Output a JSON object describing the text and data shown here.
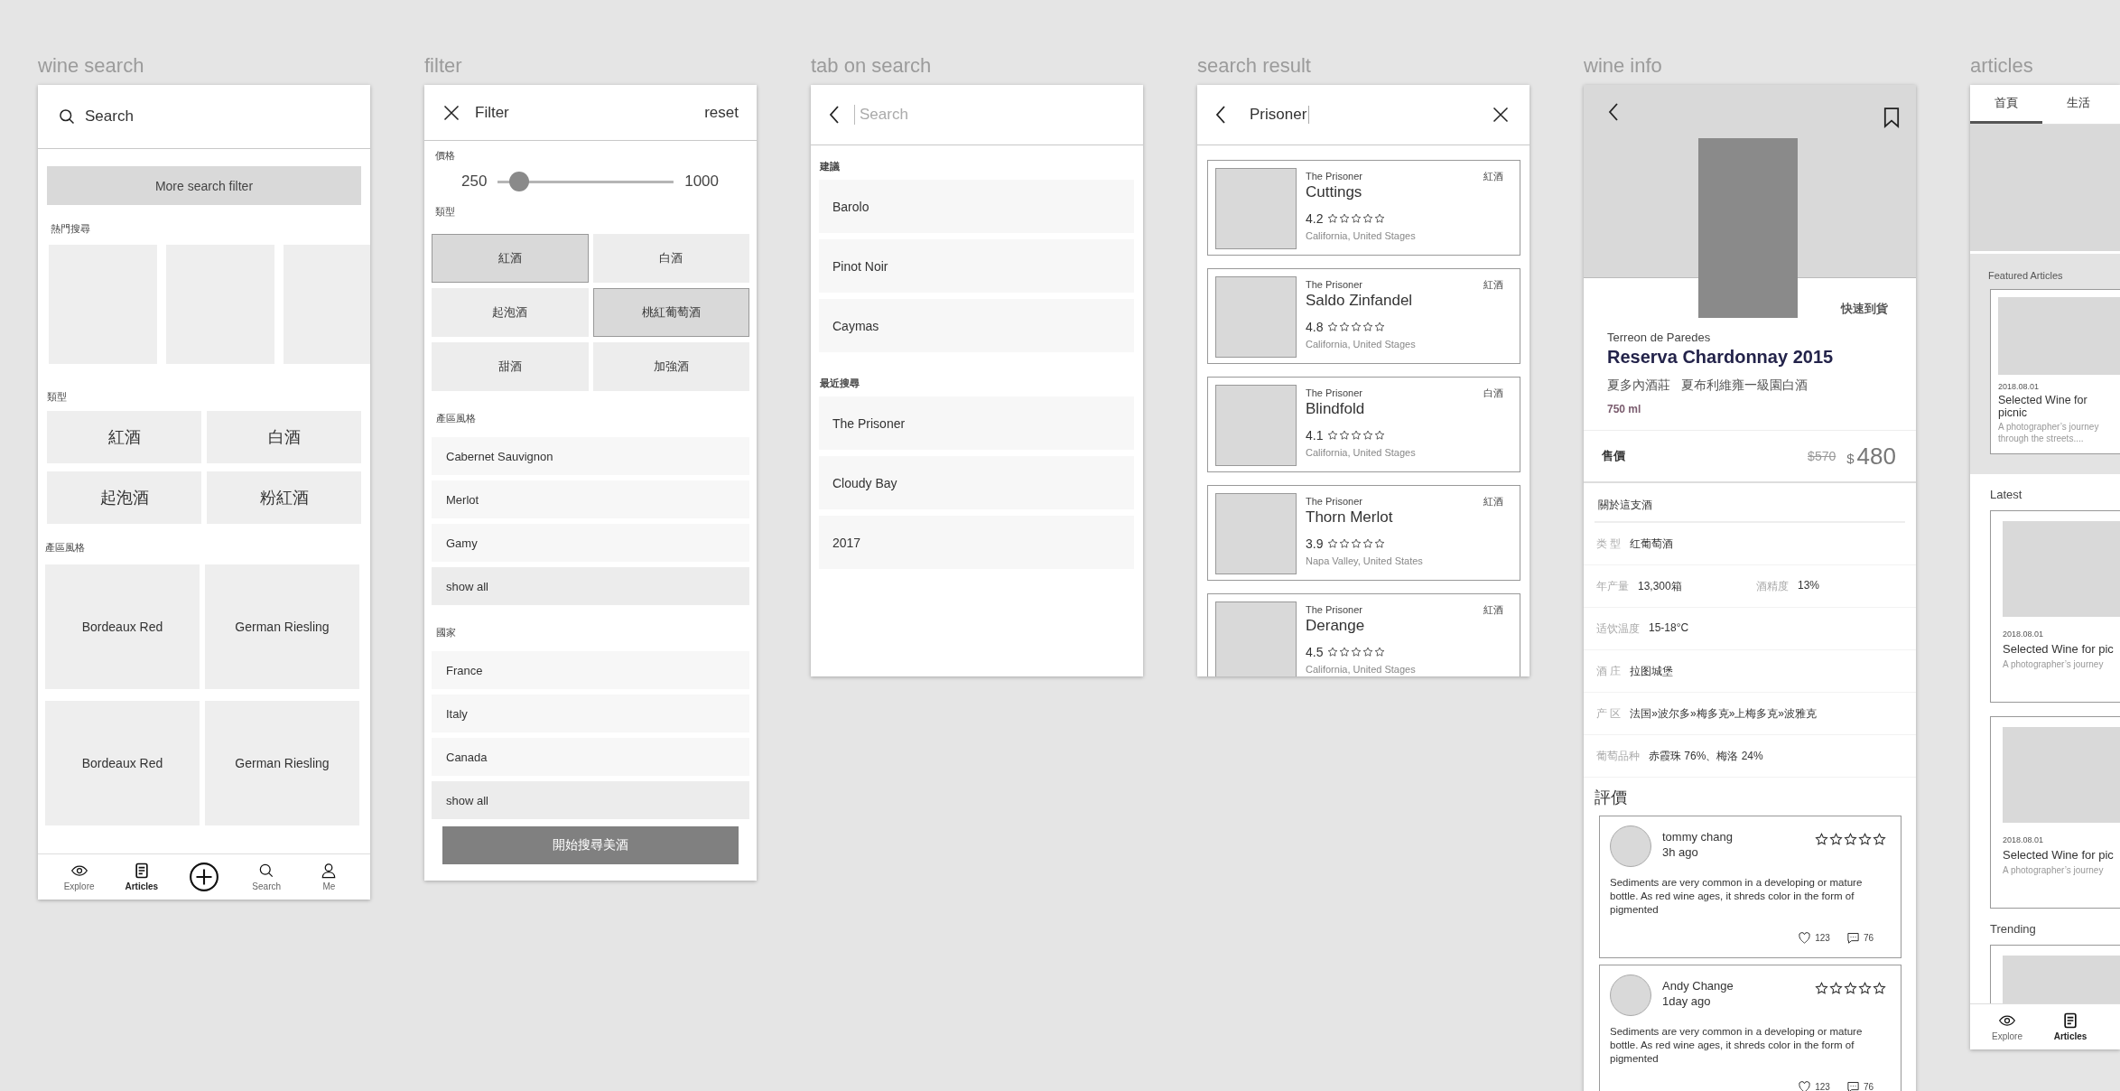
{
  "wine_search": {
    "title": "wine search",
    "search": {
      "placeholder": "Search"
    },
    "filter_button": "More search filter",
    "popular": {
      "heading": "熱門搜尋"
    },
    "types": {
      "heading": "類型",
      "items": [
        "紅酒",
        "白酒",
        "起泡酒",
        "粉紅酒"
      ]
    },
    "regions": {
      "heading": "產區風格",
      "items": [
        "Bordeaux Red",
        "German Riesling",
        "Bordeaux Red",
        "German Riesling"
      ]
    },
    "nav": [
      {
        "kind": "explore",
        "label": "Explore",
        "selected": false
      },
      {
        "kind": "articles",
        "label": "Articles",
        "selected": true
      },
      {
        "kind": "add",
        "selected": false
      },
      {
        "kind": "search",
        "label": "Search",
        "selected": false
      },
      {
        "kind": "me",
        "label": "Me",
        "selected": false
      }
    ]
  },
  "filter": {
    "title": "filter",
    "header": {
      "title": "Filter",
      "reset": "reset"
    },
    "price": {
      "heading": "價格",
      "min": "250",
      "max": "1000",
      "level": 0.12
    },
    "types": {
      "heading": "類型",
      "items": [
        {
          "label": "紅酒",
          "selected": true
        },
        {
          "label": "白酒",
          "selected": false
        },
        {
          "label": "起泡酒",
          "selected": false
        },
        {
          "label": "桃紅葡萄酒",
          "selected": true
        },
        {
          "label": "甜酒",
          "selected": false
        },
        {
          "label": "加強酒",
          "selected": false
        }
      ]
    },
    "regions": {
      "heading": "產區風格",
      "items": [
        {
          "kind": "option",
          "label": "Cabernet Sauvignon"
        },
        {
          "kind": "option",
          "label": "Merlot"
        },
        {
          "kind": "option",
          "label": "Gamy"
        },
        {
          "kind": "more",
          "label": "show all"
        }
      ]
    },
    "countries": {
      "heading": "國家",
      "items": [
        {
          "kind": "option",
          "label": "France"
        },
        {
          "kind": "option",
          "label": "Italy"
        },
        {
          "kind": "option",
          "label": "Canada"
        },
        {
          "kind": "more",
          "label": "show all"
        }
      ]
    },
    "submit": "開始搜尋美酒"
  },
  "tab_on_search": {
    "title": "tab on search",
    "search": {
      "placeholder": "Search"
    },
    "sections": [
      {
        "heading": "建議",
        "items": [
          "Barolo",
          "Pinot Noir",
          "Caymas"
        ]
      },
      {
        "heading": "最近搜尋",
        "items": [
          "The Prisoner",
          "Cloudy Bay",
          "2017"
        ]
      }
    ]
  },
  "search_result": {
    "title": "search result",
    "search": {
      "value": "Prisoner"
    },
    "results": [
      {
        "producer": "The Prisoner",
        "name": "Cuttings",
        "rating": "4.2",
        "stars": 0,
        "location": "California, United Stages",
        "type": "紅酒"
      },
      {
        "producer": "The Prisoner",
        "name": "Saldo Zinfandel",
        "rating": "4.8",
        "stars": 0,
        "location": "California, United Stages",
        "type": "紅酒"
      },
      {
        "producer": "The Prisoner",
        "name": "Blindfold",
        "rating": "4.1",
        "stars": 0,
        "location": "California, United Stages",
        "type": "白酒"
      },
      {
        "producer": "The Prisoner",
        "name": "Thorn Merlot",
        "rating": "3.9",
        "stars": 0,
        "location": "Napa Valley, United States",
        "type": "紅酒"
      },
      {
        "producer": "The Prisoner",
        "name": "Derange",
        "rating": "4.5",
        "stars": 0,
        "location": "California, United Stages",
        "type": "紅酒"
      }
    ]
  },
  "wine_info": {
    "title": "wine info",
    "delivery": "快速到貨",
    "producer": "Terreon de Paredes",
    "name": "Reserva Chardonnay 2015",
    "subtitle": "夏多內酒莊 夏布利維雍一級園白酒",
    "volume": "750 ml",
    "price": {
      "label": "售價",
      "original": "$570",
      "currency": "$",
      "amount": "480"
    },
    "about": {
      "heading": "關於這支酒",
      "rows": [
        [
          {
            "label": "类 型",
            "value": "红葡萄酒"
          }
        ],
        [
          {
            "label": "年产量",
            "value": "13,300箱"
          },
          {
            "label": "酒精度",
            "value": "13%"
          }
        ],
        [
          {
            "label": "适饮温度",
            "value": "15-18°C"
          }
        ],
        [
          {
            "label": "酒 庄",
            "value": "拉图城堡"
          }
        ],
        [
          {
            "label": "产 区",
            "value": "法国»波尔多»梅多克»上梅多克»波雅克"
          }
        ],
        [
          {
            "label": "葡萄品种",
            "value": "赤霞珠 76%、梅洛 24%"
          }
        ]
      ]
    },
    "reviews": {
      "heading": "評價",
      "items": [
        {
          "name": "tommy chang",
          "time": "3h ago",
          "stars": 0,
          "text": "Sediments are very common in a developing or mature bottle. As red wine ages, it shreds color in the form of pigmented",
          "likes": "123",
          "comments": "76"
        },
        {
          "name": "Andy Change",
          "time": "1day ago",
          "stars": 0,
          "text": "Sediments are very common in a developing or mature bottle. As red wine ages, it shreds color in the form of pigmented",
          "likes": "123",
          "comments": "76"
        }
      ]
    }
  },
  "articles": {
    "title": "articles",
    "tabs": [
      {
        "label": "首頁",
        "selected": true
      },
      {
        "label": "生活",
        "selected": false
      }
    ],
    "featured": {
      "heading": "Featured Articles",
      "items": [
        {
          "date": "2018.08.01",
          "title": "Selected Wine for picnic",
          "excerpt": "A photographer’s journey through the streets...."
        }
      ]
    },
    "latest": {
      "heading": "Latest",
      "items": [
        {
          "date": "2018.08.01",
          "title": "Selected Wine for pic",
          "excerpt": "A photographer’s journey"
        },
        {
          "date": "2018.08.01",
          "title": "Selected Wine for pic",
          "excerpt": "A photographer’s journey"
        }
      ]
    },
    "trending": {
      "heading": "Trending"
    },
    "nav": [
      {
        "kind": "explore",
        "label": "Explore",
        "selected": false
      },
      {
        "kind": "articles",
        "label": "Articles",
        "selected": true
      }
    ]
  }
}
